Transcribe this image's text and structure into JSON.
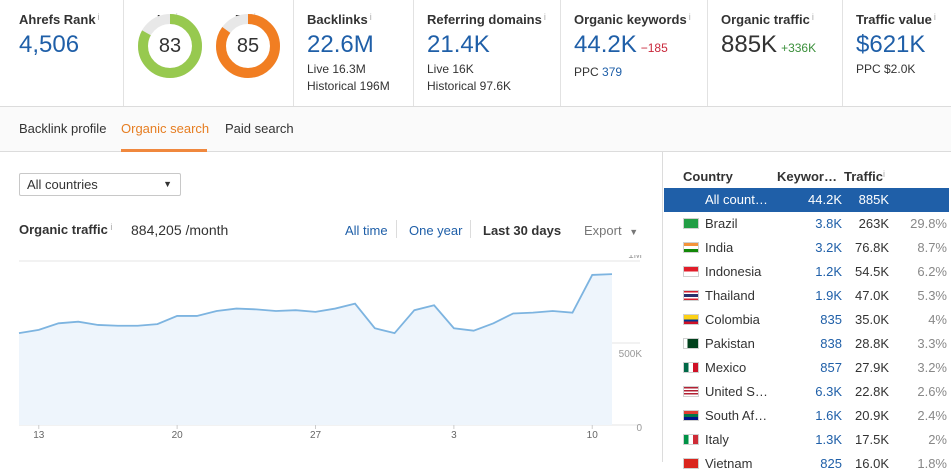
{
  "metrics": {
    "ahrefs_rank": {
      "label": "Ahrefs Rank",
      "value": "4,506"
    },
    "ur": {
      "label": "UR",
      "value": "83",
      "percent": 83,
      "color": "#97c94f"
    },
    "dr": {
      "label": "DR",
      "value": "85",
      "percent": 85,
      "color": "#f17e22"
    },
    "backlinks": {
      "label": "Backlinks",
      "value": "22.6M",
      "sub1": "Live 16.3M",
      "sub2": "Historical 196M"
    },
    "referring_domains": {
      "label": "Referring domains",
      "value": "21.4K",
      "sub1": "Live 16K",
      "sub2": "Historical 97.6K"
    },
    "organic_keywords": {
      "label": "Organic keywords",
      "value": "44.2K",
      "delta": "−185",
      "ppc_label": "PPC",
      "ppc_value": "379"
    },
    "organic_traffic": {
      "label": "Organic traffic",
      "value": "885K",
      "delta": "+336K"
    },
    "traffic_value": {
      "label": "Traffic value",
      "value": "$621K",
      "sub1": "PPC $2.0K"
    }
  },
  "tabs": {
    "backlink_profile": "Backlink profile",
    "organic_search": "Organic search",
    "paid_search": "Paid search"
  },
  "filter": {
    "country_select": "All countries"
  },
  "chart_header": {
    "title": "Organic traffic",
    "value": "884,205 /month",
    "ranges": {
      "all_time": "All time",
      "one_year": "One year",
      "last_30_days": "Last 30 days"
    },
    "export": "Export"
  },
  "chart_data": {
    "type": "area",
    "title": "",
    "xlabel": "",
    "ylabel": "",
    "x_tick_labels": [
      "13",
      "20",
      "27",
      "3",
      "10"
    ],
    "y_tick_labels": [
      "1M",
      "500K",
      "0"
    ],
    "ylim": [
      0,
      1000000
    ],
    "values": [
      560000,
      580000,
      620000,
      630000,
      610000,
      605000,
      605000,
      615000,
      665000,
      665000,
      695000,
      710000,
      705000,
      695000,
      700000,
      690000,
      710000,
      740000,
      590000,
      560000,
      700000,
      730000,
      590000,
      575000,
      620000,
      680000,
      685000,
      695000,
      685000,
      915000,
      920000
    ],
    "color": "#7db4e0",
    "fill": "#eef5fc",
    "grid": true
  },
  "countries_panel": {
    "headers": {
      "country": "Country",
      "keywords": "Keywor…",
      "traffic": "Traffic"
    },
    "rows": [
      {
        "name": "All count…",
        "keywords": "44.2K",
        "traffic": "885K",
        "pct": "",
        "flag": "",
        "selected": true
      },
      {
        "name": "Brazil",
        "keywords": "3.8K",
        "traffic": "263K",
        "pct": "29.8%",
        "flag": "br"
      },
      {
        "name": "India",
        "keywords": "3.2K",
        "traffic": "76.8K",
        "pct": "8.7%",
        "flag": "in"
      },
      {
        "name": "Indonesia",
        "keywords": "1.2K",
        "traffic": "54.5K",
        "pct": "6.2%",
        "flag": "id"
      },
      {
        "name": "Thailand",
        "keywords": "1.9K",
        "traffic": "47.0K",
        "pct": "5.3%",
        "flag": "th"
      },
      {
        "name": "Colombia",
        "keywords": "835",
        "traffic": "35.0K",
        "pct": "4%",
        "flag": "co"
      },
      {
        "name": "Pakistan",
        "keywords": "838",
        "traffic": "28.8K",
        "pct": "3.3%",
        "flag": "pk"
      },
      {
        "name": "Mexico",
        "keywords": "857",
        "traffic": "27.9K",
        "pct": "3.2%",
        "flag": "mx"
      },
      {
        "name": "United S…",
        "keywords": "6.3K",
        "traffic": "22.8K",
        "pct": "2.6%",
        "flag": "us"
      },
      {
        "name": "South Af…",
        "keywords": "1.6K",
        "traffic": "20.9K",
        "pct": "2.4%",
        "flag": "za"
      },
      {
        "name": "Italy",
        "keywords": "1.3K",
        "traffic": "17.5K",
        "pct": "2%",
        "flag": "it"
      },
      {
        "name": "Vietnam",
        "keywords": "825",
        "traffic": "16.0K",
        "pct": "1.8%",
        "flag": "vn"
      }
    ]
  },
  "colors": {
    "accent": "#1f5fa8",
    "active_tab": "#e67e22",
    "negative": "#c9283b",
    "positive": "#3a8f3a"
  }
}
